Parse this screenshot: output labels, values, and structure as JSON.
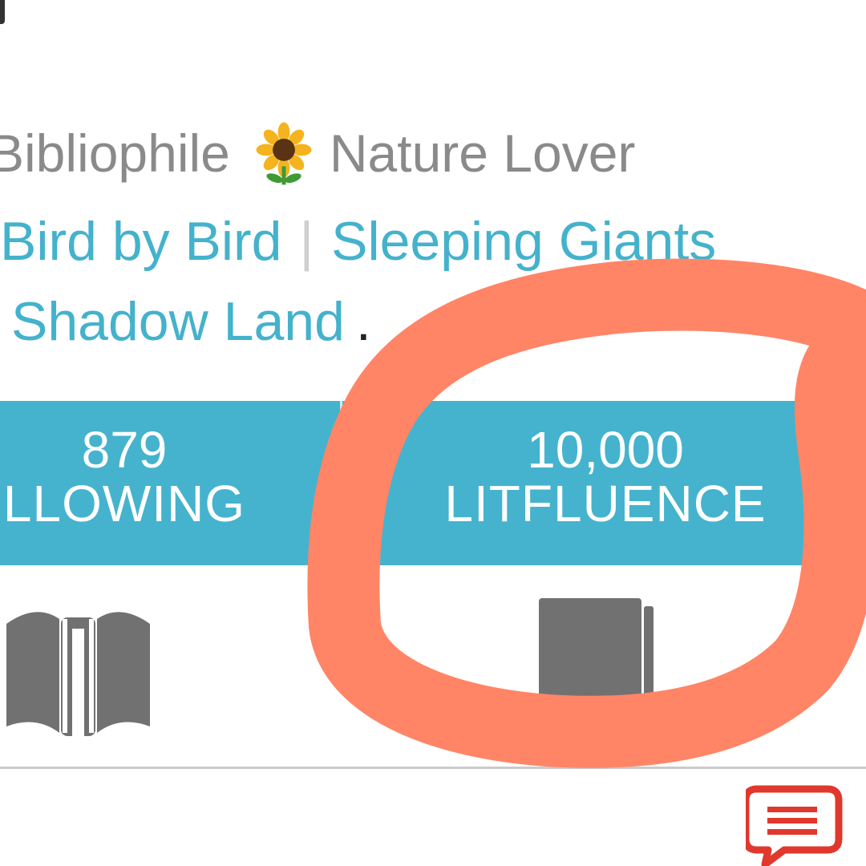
{
  "profile": {
    "bio": {
      "text_before": "Bibliophile",
      "emoji_icon": "sunflower-icon",
      "text_after": "Nature Lover"
    },
    "favorite_books": [
      "Bird by Bird",
      "Sleeping Giants",
      "Shadow Land"
    ],
    "separator": "|",
    "trailing_text": "."
  },
  "stats": {
    "following": {
      "value": "879",
      "label": "LLOWING"
    },
    "litfluence": {
      "value": "10,000",
      "label": "LITFLUENCE"
    }
  },
  "icons": {
    "open_book": "open-book-icon",
    "closed_book": "closed-book-icon",
    "comment": "comment-icon"
  },
  "colors": {
    "accent": "#45b3cd",
    "link": "#44b2cc",
    "annotation": "#ff8566",
    "icon_gray": "#717171",
    "comment_red": "#e0382c",
    "bio_text": "#8a8a8a"
  }
}
